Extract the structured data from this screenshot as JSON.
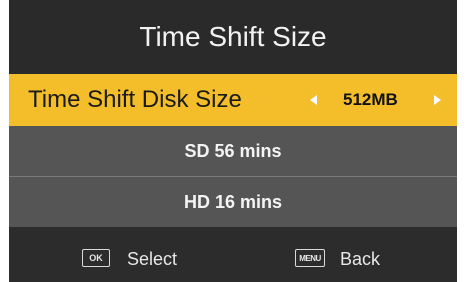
{
  "title": "Time Shift Size",
  "selected_row": {
    "label": "Time Shift Disk Size",
    "value": "512MB",
    "left_arrow_icon": "triangle-left-icon",
    "right_arrow_icon": "triangle-right-icon"
  },
  "rows": [
    {
      "label": "SD 56 mins"
    },
    {
      "label": "HD 16 mins"
    }
  ],
  "footer": {
    "ok_key": "OK",
    "ok_hint": "Select",
    "menu_key": "MENU",
    "menu_hint": "Back"
  },
  "colors": {
    "highlight": "#f4be2a",
    "panel": "#2c2c2c",
    "row": "#555555"
  }
}
